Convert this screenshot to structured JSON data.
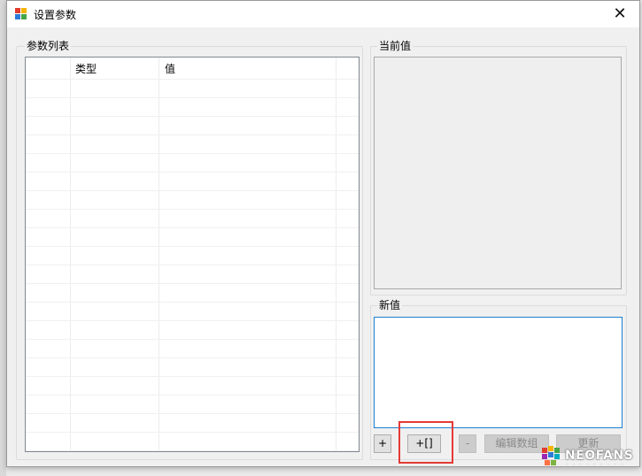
{
  "window": {
    "title": "设置参数",
    "close_glyph": "✕",
    "app_icon": "app-icon"
  },
  "param_list": {
    "group_title": "参数列表",
    "columns": [
      "",
      "类型",
      "值",
      ""
    ],
    "rows": []
  },
  "current_value": {
    "group_title": "当前值",
    "value": ""
  },
  "new_value": {
    "group_title": "新值",
    "value": ""
  },
  "buttons": {
    "add": "+",
    "add_array": "+[]",
    "remove": "-",
    "edit_array": "编辑数组",
    "update": "更新"
  },
  "watermark": {
    "text": "NEOFANS",
    "sub": "· · · · · · · · ·"
  },
  "colors": {
    "highlight": "#e53935",
    "focus_border": "#1e7fd0"
  }
}
